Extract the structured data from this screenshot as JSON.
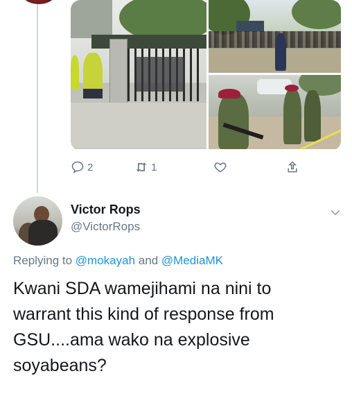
{
  "previous_tweet": {
    "media": [
      {
        "description": "gate-scene"
      },
      {
        "description": "crowd-scene"
      },
      {
        "description": "police-scene"
      }
    ],
    "actions": {
      "reply_count": "2",
      "retweet_count": "1",
      "like_count": "",
      "icons": [
        "reply-icon",
        "retweet-icon",
        "like-icon",
        "share-icon"
      ]
    }
  },
  "tweet": {
    "author_name": "Victor Rops",
    "author_handle": "@VictorRops",
    "replying_prefix": "Replying to",
    "replying_to_1": "@mokayah",
    "replying_joiner": "and",
    "replying_to_2": "@MediaMK",
    "text_line_1": "Kwani SDA wamejihami na nini to",
    "text_line_2": "warrant this kind of response from",
    "text_line_3": "GSU....ama wako na explosive",
    "text_line_4": "soyabeans?"
  },
  "colors": {
    "accent": "#1b95e0",
    "secondary_text": "#657786",
    "thread_line": "#ccd6dd"
  }
}
